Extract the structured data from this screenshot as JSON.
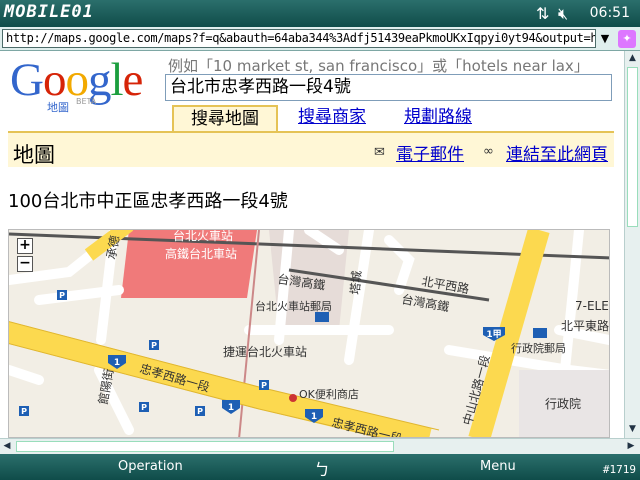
{
  "titlebar": {
    "brand": "MOBILE01",
    "icons": [
      "connectivity-icon",
      "speaker-muted-icon",
      "close-icon"
    ],
    "time": "06:51"
  },
  "addressbar": {
    "url": "http://maps.google.com/maps?f=q&abauth=64aba344%3Adfj51439eaPkmoUKxIqpyi0yt94&output=ht"
  },
  "google": {
    "logo": "Google",
    "logo_sub": "地圖",
    "logo_beta": "BETA",
    "logo_colors": [
      "#3366cc",
      "#d62408",
      "#f2a900",
      "#3366cc",
      "#1b9e3e",
      "#d62408"
    ],
    "hint": "例如「10 market st, san francisco」或「hotels near lax」",
    "search_value": "台北市忠孝西路一段4號"
  },
  "tabs": {
    "maps": "搜尋地圖",
    "business": "搜尋商家",
    "directions": "規劃路線"
  },
  "mapbar": {
    "title": "地圖",
    "email": "電子郵件",
    "link": "連結至此網頁"
  },
  "result": {
    "address": "100台北市中正區忠孝西路一段4號"
  },
  "map": {
    "zoom_in": "+",
    "zoom_out": "−",
    "labels": {
      "station_top": "台北火車站",
      "hsr_station": "高鐵台北車站",
      "taiwan_hsr_1": "台灣高鐵",
      "beiping_w": "北平西路",
      "taiwan_hsr_2": "台灣高鐵",
      "beiping_e": "北平東路",
      "seven": "7-ELE",
      "station_post": "台北火車站郵局",
      "mrt": "捷運台北火車站",
      "zhongxiao_w": "忠孝西路一段",
      "zhongxiao_w2": "忠孝西路一段",
      "ok_store": "OK便利商店",
      "zhongshan_n": "中山北路一段",
      "executive_post": "行政院郵局",
      "executive": "行政院",
      "chengde": "承德",
      "taiyuan": "塔城",
      "guanyang": "館陽街",
      "route_1a": "1",
      "route_1b": "1",
      "route_1c": "1",
      "route_jia": "1甲"
    },
    "colors": {
      "background": "#f2eee5",
      "highway": "#fcd94f",
      "road": "#ffffff",
      "rail": "#555555",
      "station": "#f07a7a"
    }
  },
  "softkeys": {
    "left": "Operation",
    "center": "ㄅ",
    "right": "Menu",
    "build": "#1719"
  }
}
